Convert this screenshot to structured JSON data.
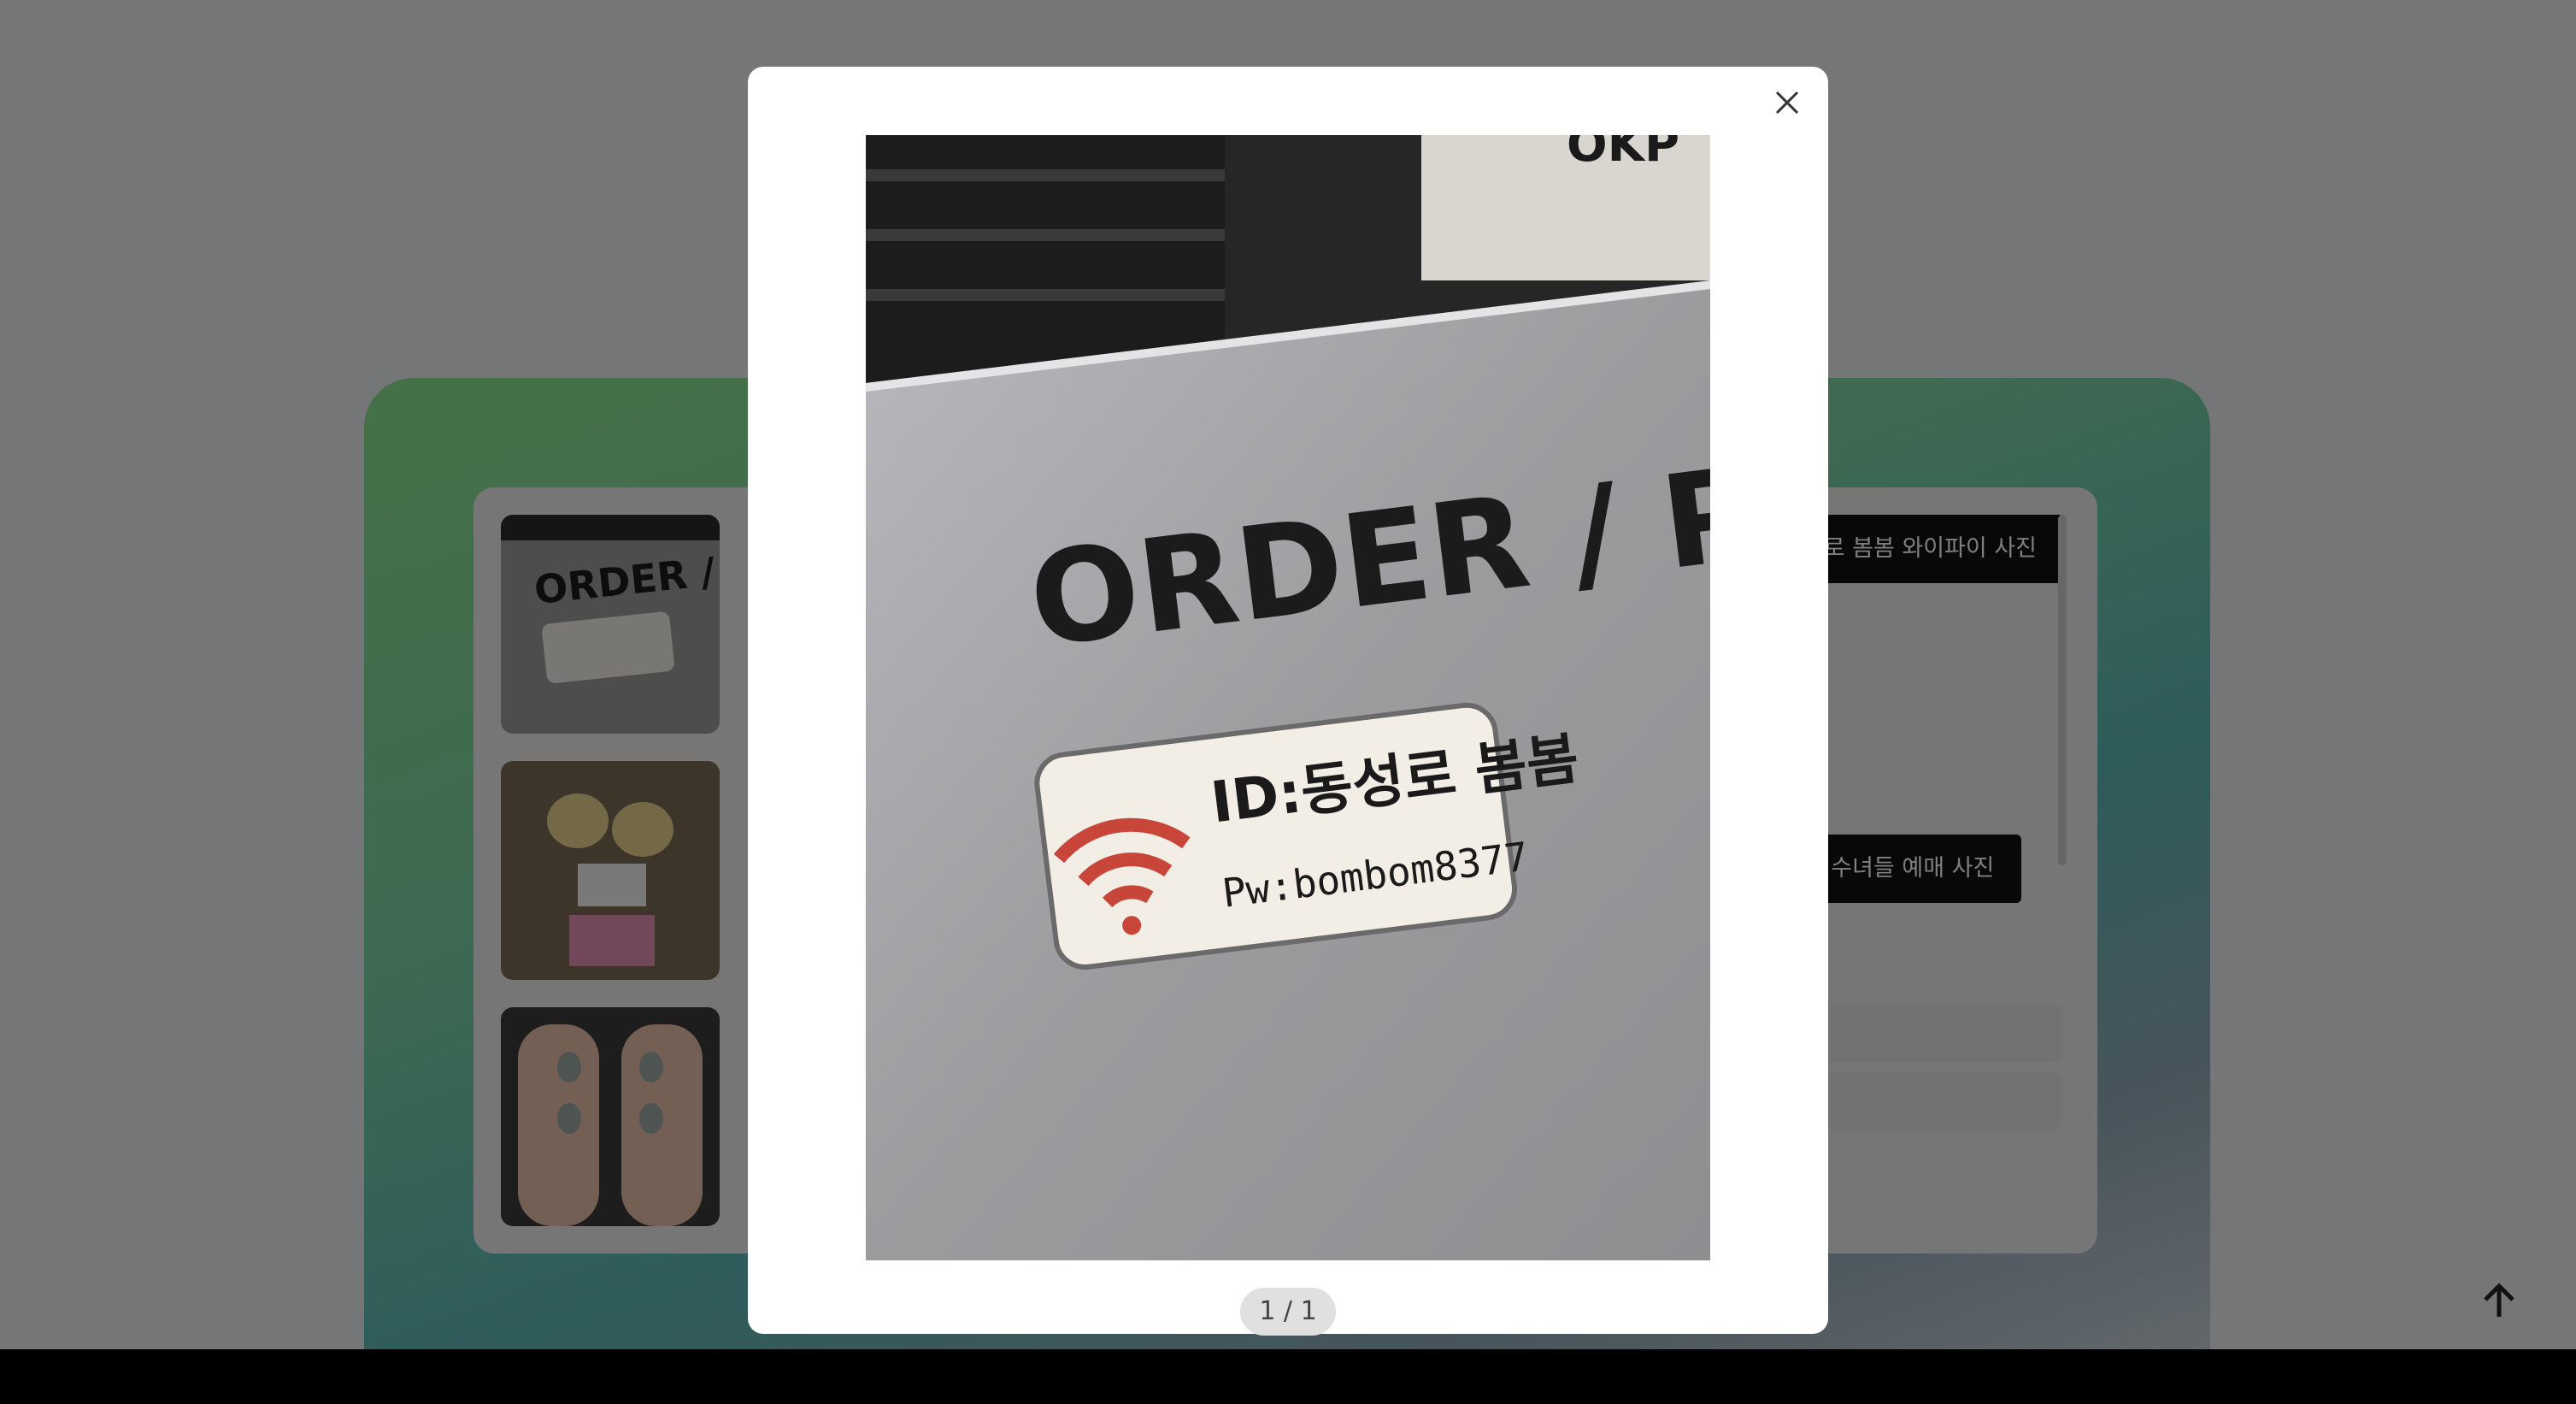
{
  "page": {
    "tags": [
      "동성로 봄봄 와이파이 사진",
      "검은 수녀들 예매 사진"
    ],
    "thumbnails": [
      {
        "icon": "wifi-sign-photo"
      },
      {
        "icon": "hello-kitty-photo"
      },
      {
        "icon": "nail-art-photo"
      }
    ]
  },
  "viewer": {
    "counter": "1 / 1",
    "close_icon": "close-icon",
    "photo": {
      "sign_text": "ORDER / P",
      "wifi_id": "ID:동성로 봄봄",
      "wifi_pw": "Pw:bombom8377",
      "top_text": "OKP"
    }
  },
  "scroll_top_icon": "arrow-up-icon",
  "colors": {
    "overlay": "rgba(0,0,0,0.5)",
    "tag_bg": "#111111",
    "wifi_red": "#c8453a"
  }
}
